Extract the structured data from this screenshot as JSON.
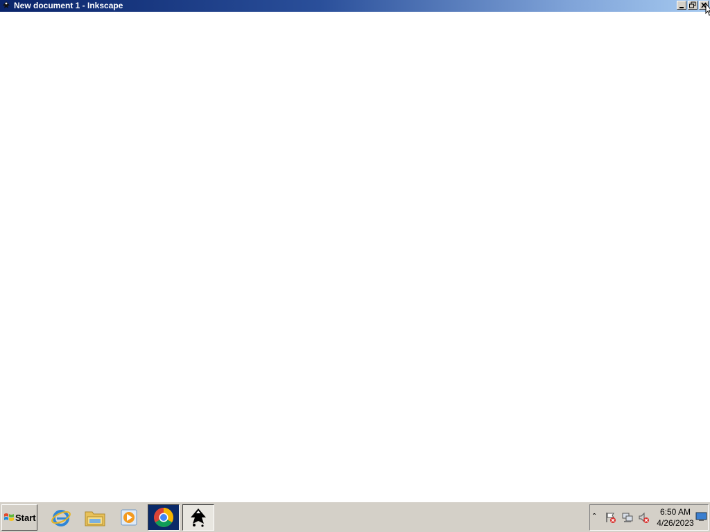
{
  "window": {
    "title": "New document 1 - Inkscape",
    "buttons": [
      "minimize",
      "restore",
      "close"
    ]
  },
  "taskbar": {
    "start_label": "Start",
    "pinned": [
      {
        "name": "internet-explorer-icon"
      },
      {
        "name": "file-explorer-icon"
      },
      {
        "name": "media-player-icon"
      },
      {
        "name": "chrome-icon"
      },
      {
        "name": "inkscape-icon"
      }
    ],
    "tray": {
      "icons": [
        "action-center-flag-icon",
        "network-icon",
        "volume-muted-icon"
      ],
      "time": "6:50 AM",
      "date": "4/26/2023"
    }
  }
}
